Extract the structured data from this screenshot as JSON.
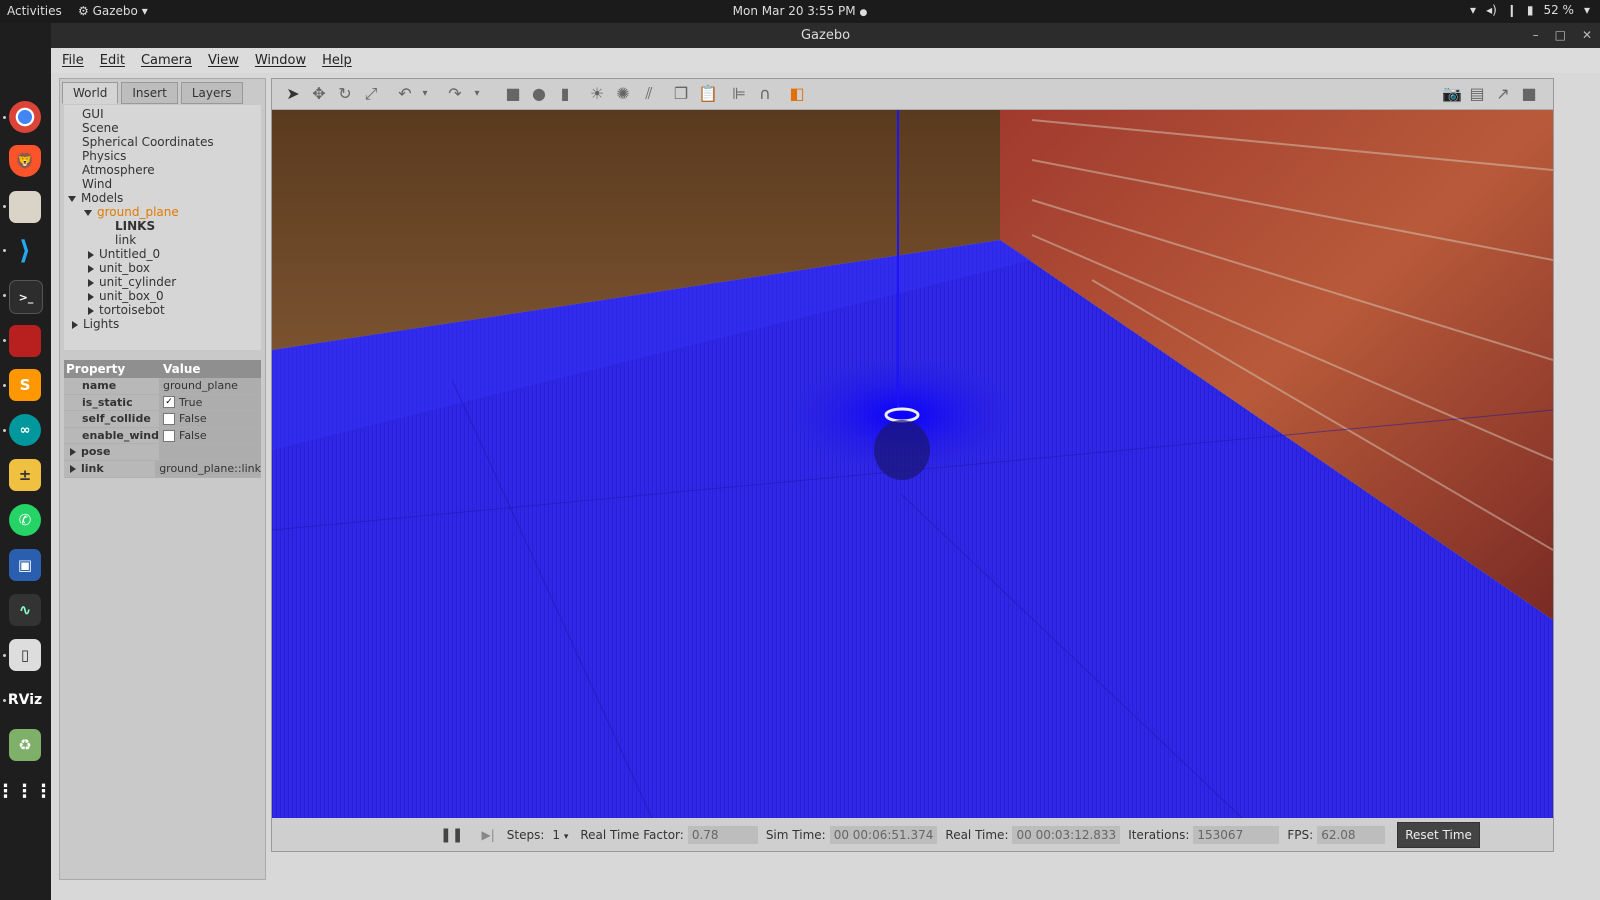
{
  "topbar": {
    "activities": "Activities",
    "app_name": "Gazebo",
    "datetime": "Mon Mar 20  3:55 PM",
    "battery": "52 %"
  },
  "dock": {
    "items": [
      "chrome-icon",
      "brave-icon",
      "files-icon",
      "vscode-icon",
      "terminal-icon",
      "sysmon-icon",
      "sublime-icon",
      "arduino-icon",
      "calculator-icon",
      "whatsapp-icon",
      "remote-desktop-icon",
      "activity-icon",
      "usb-drive-icon",
      "rviz-icon",
      "trash-icon",
      "app-grid-icon"
    ],
    "rviz_label": "RViz"
  },
  "window": {
    "title": "Gazebo"
  },
  "menu": [
    "File",
    "Edit",
    "Camera",
    "View",
    "Window",
    "Help"
  ],
  "tabs": [
    "World",
    "Insert",
    "Layers"
  ],
  "tree": {
    "items": [
      "GUI",
      "Scene",
      "Spherical Coordinates",
      "Physics",
      "Atmosphere",
      "Wind"
    ],
    "models_label": "Models",
    "selected_model": "ground_plane",
    "links_label": "LINKS",
    "link_label": "link",
    "models": [
      "Untitled_0",
      "unit_box",
      "unit_cylinder",
      "unit_box_0",
      "tortoisebot"
    ],
    "lights_label": "Lights"
  },
  "properties": {
    "header_property": "Property",
    "header_value": "Value",
    "name_key": "name",
    "name_value": "ground_plane",
    "is_static_key": "is_static",
    "is_static_value": "True",
    "self_collide_key": "self_collide",
    "self_collide_value": "False",
    "enable_wind_key": "enable_wind",
    "enable_wind_value": "False",
    "pose_key": "pose",
    "link_key": "link",
    "link_value": "ground_plane::link"
  },
  "status": {
    "steps_label": "Steps:",
    "steps_value": "1",
    "rtf_label": "Real Time Factor:",
    "rtf_value": "0.78",
    "sim_time_label": "Sim Time:",
    "sim_time_value": "00 00:06:51.374",
    "real_time_label": "Real Time:",
    "real_time_value": "00 00:03:12.833",
    "iterations_label": "Iterations:",
    "iterations_value": "153067",
    "fps_label": "FPS:",
    "fps_value": "62.08",
    "reset_label": "Reset Time"
  },
  "colors": {
    "selected": "#e07b00",
    "floor": "#2a1fe0",
    "wood": "#6a4322",
    "brick": "#8a2f2a"
  }
}
